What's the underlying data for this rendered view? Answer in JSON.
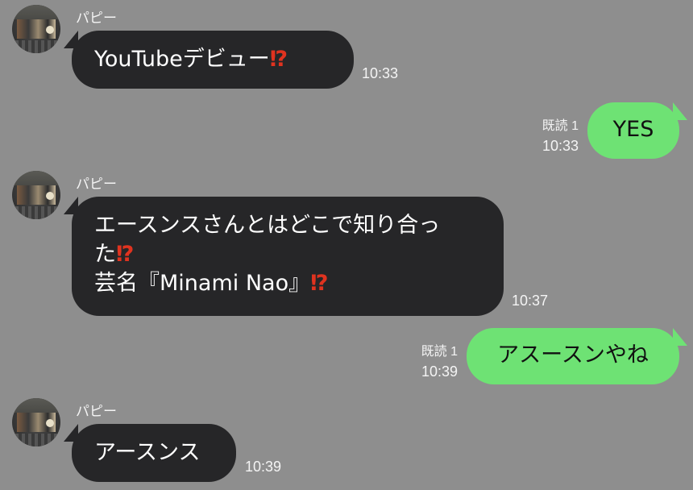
{
  "colors": {
    "background": "#8e8e8e",
    "incoming_bubble": "#262628",
    "outgoing_bubble": "#6ee274",
    "exclamation_question_mark": "#e0331f"
  },
  "messages": [
    {
      "direction": "incoming",
      "sender": "パピー",
      "text": "YouTubeデビュー",
      "emoji": "⁉",
      "time": "10:33"
    },
    {
      "direction": "outgoing",
      "text": "YES",
      "read_label": "既読 1",
      "time": "10:33"
    },
    {
      "direction": "incoming",
      "sender": "パピー",
      "line1": "エースンスさんとはどこで知り合っ",
      "line2": "た",
      "line3": "芸名『Minami Nao』",
      "emoji": "⁉",
      "time": "10:37"
    },
    {
      "direction": "outgoing",
      "text": "アスースンやね",
      "read_label": "既読 1",
      "time": "10:39"
    },
    {
      "direction": "incoming",
      "sender": "パピー",
      "text": "アースンス",
      "time": "10:39"
    }
  ]
}
